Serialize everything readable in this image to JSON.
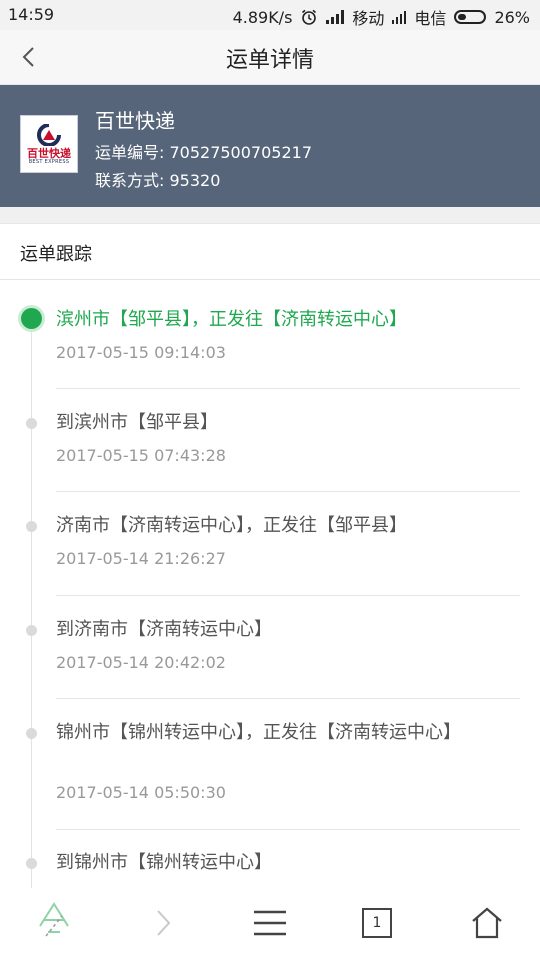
{
  "status_bar": {
    "time": "14:59",
    "speed": "4.89K/s",
    "carrier1": "移动",
    "carrier2": "电信",
    "battery": "26%"
  },
  "nav": {
    "title": "运单详情"
  },
  "courier": {
    "name": "百世快递",
    "waybill": "运单编号: 70527500705217",
    "contact": "联系方式: 95320",
    "logo_main": "百世快递",
    "logo_sub": "BEST EXPRESS"
  },
  "tracking": {
    "section_title": "运单跟踪",
    "events": [
      {
        "text": "滨州市【邹平县】，正发往【济南转运中心】",
        "time": "2017-05-15 09:14:03"
      },
      {
        "text": "到滨州市【邹平县】",
        "time": "2017-05-15 07:43:28"
      },
      {
        "text": "济南市【济南转运中心】，正发往【邹平县】",
        "time": "2017-05-14 21:26:27"
      },
      {
        "text": "到济南市【济南转运中心】",
        "time": "2017-05-14 20:42:02"
      },
      {
        "text": "锦州市【锦州转运中心】，正发往【济南转运中心】",
        "time": "2017-05-14 05:50:30"
      },
      {
        "text": "到锦州市【锦州转运中心】",
        "time": ""
      }
    ]
  },
  "bottom_bar": {
    "tab_count": "1"
  },
  "colors": {
    "accent": "#1fa84f",
    "header_bg": "#566579"
  }
}
